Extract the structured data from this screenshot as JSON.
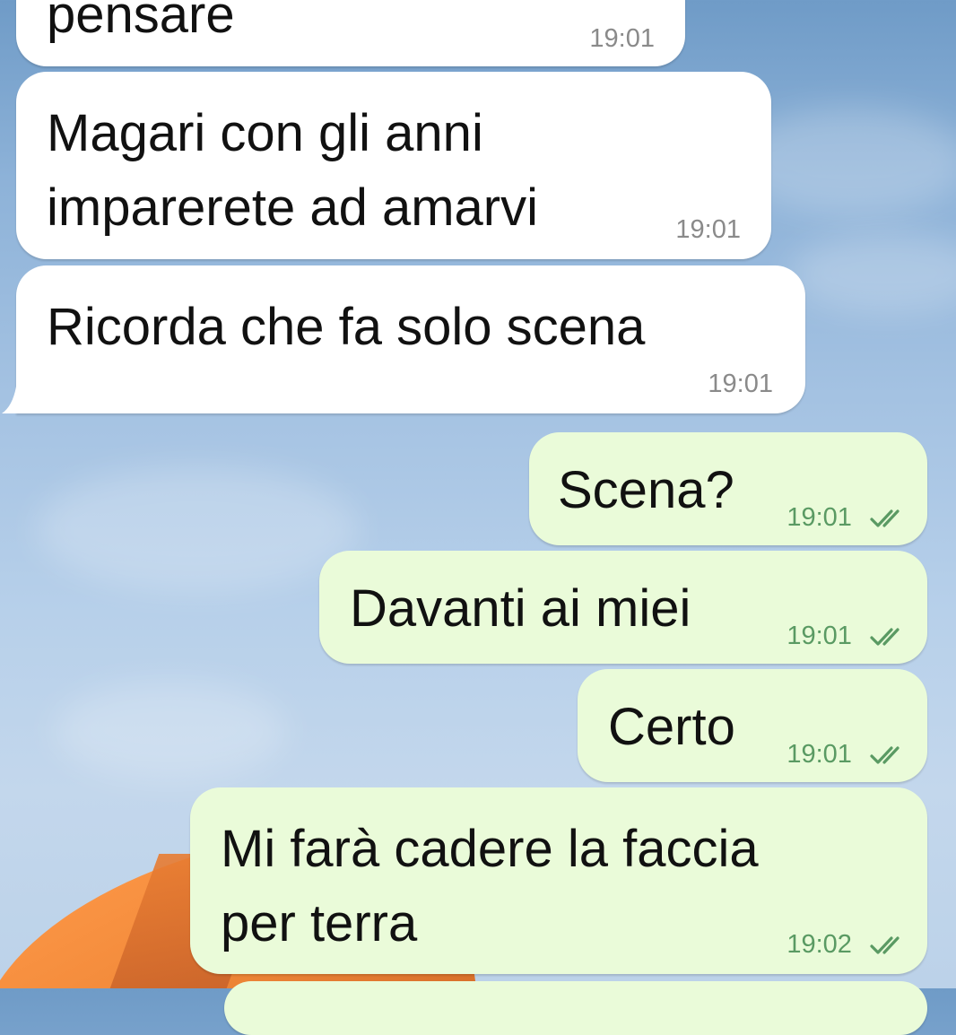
{
  "chat": {
    "messages": [
      {
        "direction": "incoming",
        "lines": [
          "pensare"
        ],
        "time": "19:01"
      },
      {
        "direction": "incoming",
        "lines": [
          "Magari con gli anni",
          "imparerete ad amarvi"
        ],
        "time": "19:01"
      },
      {
        "direction": "incoming",
        "lines": [
          "Ricorda che fa solo scena"
        ],
        "time": "19:01"
      },
      {
        "direction": "outgoing",
        "lines": [
          "Scena?"
        ],
        "time": "19:01",
        "status": "read"
      },
      {
        "direction": "outgoing",
        "lines": [
          "Davanti ai miei"
        ],
        "time": "19:01",
        "status": "read"
      },
      {
        "direction": "outgoing",
        "lines": [
          "Certo"
        ],
        "time": "19:01",
        "status": "read"
      },
      {
        "direction": "outgoing",
        "lines": [
          "Mi farà cadere la faccia",
          "per terra"
        ],
        "time": "19:02",
        "status": "read"
      }
    ]
  },
  "icons": {
    "read_receipt": "double-check-icon"
  },
  "colors": {
    "incoming_bubble": "#ffffff",
    "outgoing_bubble": "#eafbd9",
    "outgoing_meta": "#5a9a63",
    "incoming_meta": "#8a8a8a"
  }
}
